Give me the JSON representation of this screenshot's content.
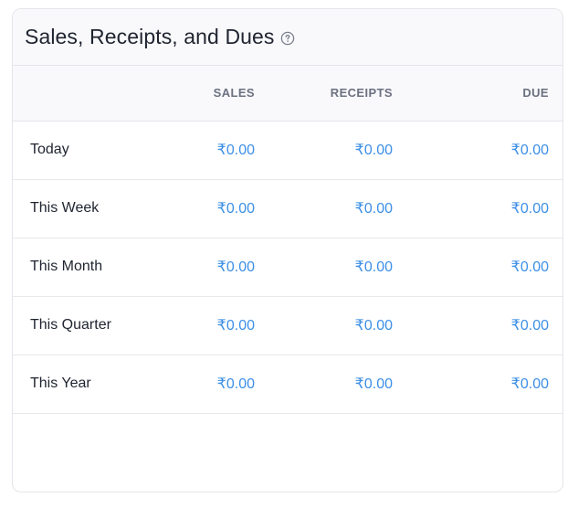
{
  "card": {
    "title": "Sales, Receipts, and Dues",
    "help_icon": "question-circle-icon"
  },
  "table": {
    "columns": [
      "",
      "SALES",
      "RECEIPTS",
      "DUE"
    ],
    "rows": [
      {
        "label": "Today",
        "sales": "₹0.00",
        "receipts": "₹0.00",
        "due": "₹0.00"
      },
      {
        "label": "This Week",
        "sales": "₹0.00",
        "receipts": "₹0.00",
        "due": "₹0.00"
      },
      {
        "label": "This Month",
        "sales": "₹0.00",
        "receipts": "₹0.00",
        "due": "₹0.00"
      },
      {
        "label": "This Quarter",
        "sales": "₹0.00",
        "receipts": "₹0.00",
        "due": "₹0.00"
      },
      {
        "label": "This Year",
        "sales": "₹0.00",
        "receipts": "₹0.00",
        "due": "₹0.00"
      }
    ]
  },
  "colors": {
    "amount": "#3c8fe6",
    "header_text": "#6b7180",
    "title_text": "#1f2430",
    "border": "#e3e5ea",
    "header_bg": "#f9f9fb"
  }
}
